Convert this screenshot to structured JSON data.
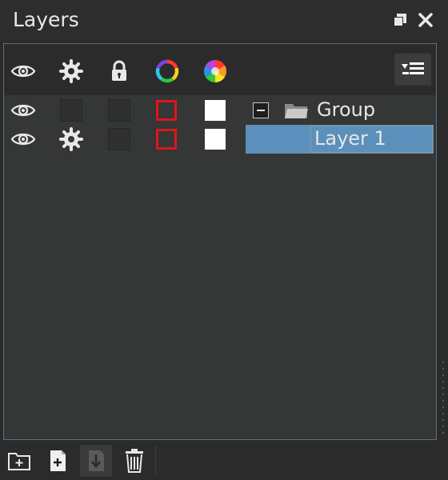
{
  "window": {
    "title": "Layers"
  },
  "header": {
    "columns": [
      {
        "icon": "eye-icon"
      },
      {
        "icon": "gear-icon"
      },
      {
        "icon": "lock-icon"
      },
      {
        "icon": "color-ring-icon"
      },
      {
        "icon": "color-wheel-icon"
      }
    ],
    "menu_icon": "layer-options-menu-icon"
  },
  "layers": [
    {
      "name": "Group",
      "type": "group",
      "expanded": true,
      "visible": true,
      "locked": false,
      "selected": false
    },
    {
      "name": "Layer 1",
      "type": "layer",
      "visible": true,
      "locked": false,
      "selected": true
    }
  ],
  "footer": {
    "buttons": [
      {
        "icon": "new-group-icon"
      },
      {
        "icon": "new-layer-icon"
      },
      {
        "icon": "merge-down-icon"
      },
      {
        "icon": "trash-icon"
      }
    ]
  },
  "colors": {
    "selection": "#5b90bc",
    "color_indicator": "#e0141a",
    "panel_border": "#52728a"
  }
}
